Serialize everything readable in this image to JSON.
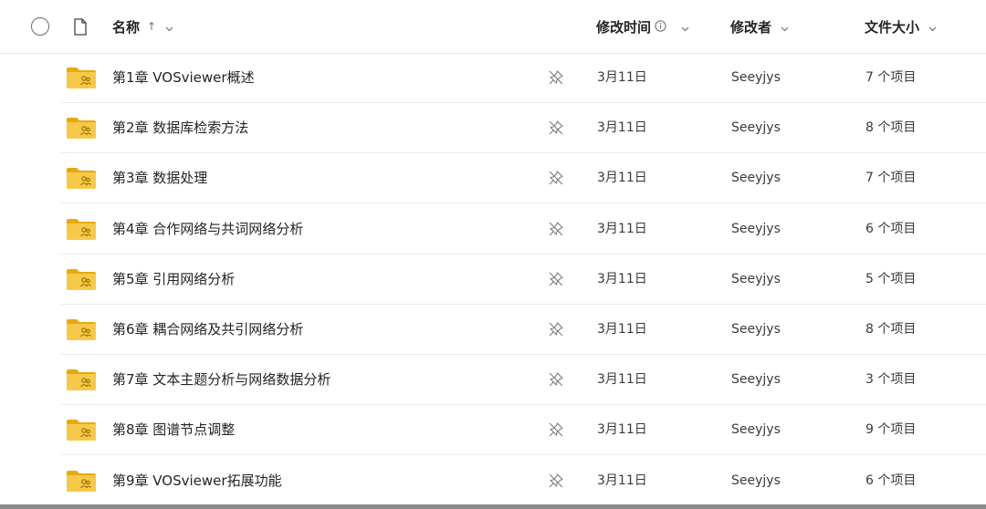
{
  "header": {
    "name_label": "名称",
    "sort_arrow": "↑",
    "modified_label": "修改时间",
    "modifier_label": "修改者",
    "size_label": "文件大小"
  },
  "icons": {
    "folder_color": "#f6c94a",
    "folder_dark": "#e8a90f",
    "accent": "#9a6b00"
  },
  "rows": [
    {
      "name": "第1章 VOSviewer概述",
      "date": "3月11日",
      "owner": "Seeyjys",
      "size": "7 个项目"
    },
    {
      "name": "第2章 数据库检索方法",
      "date": "3月11日",
      "owner": "Seeyjys",
      "size": "8 个项目"
    },
    {
      "name": "第3章 数据处理",
      "date": "3月11日",
      "owner": "Seeyjys",
      "size": "7 个项目"
    },
    {
      "name": "第4章 合作网络与共词网络分析",
      "date": "3月11日",
      "owner": "Seeyjys",
      "size": "6 个项目"
    },
    {
      "name": "第5章 引用网络分析",
      "date": "3月11日",
      "owner": "Seeyjys",
      "size": "5 个项目"
    },
    {
      "name": "第6章 耦合网络及共引网络分析",
      "date": "3月11日",
      "owner": "Seeyjys",
      "size": "8 个项目"
    },
    {
      "name": "第7章 文本主题分析与网络数据分析",
      "date": "3月11日",
      "owner": "Seeyjys",
      "size": "3 个项目"
    },
    {
      "name": "第8章 图谱节点调整",
      "date": "3月11日",
      "owner": "Seeyjys",
      "size": "9 个项目"
    },
    {
      "name": "第9章 VOSviewer拓展功能",
      "date": "3月11日",
      "owner": "Seeyjys",
      "size": "6 个项目"
    }
  ]
}
